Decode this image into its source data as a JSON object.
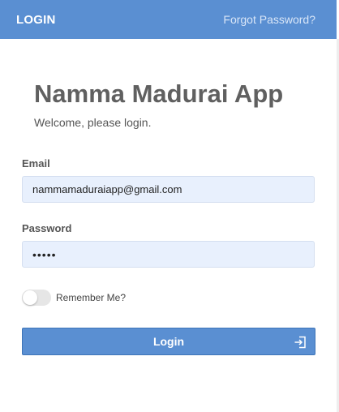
{
  "header": {
    "title": "LOGIN",
    "forgot_link": "Forgot Password?",
    "color": "#5a8fd2"
  },
  "main": {
    "app_title": "Namma Madurai App",
    "welcome": "Welcome, please login."
  },
  "form": {
    "email_label": "Email",
    "email_value": "nammamaduraiapp@gmail.com",
    "password_label": "Password",
    "password_value": "•••••",
    "remember_label": "Remember Me?",
    "remember_checked": false,
    "login_label": "Login",
    "login_icon": "login-enter-icon"
  }
}
